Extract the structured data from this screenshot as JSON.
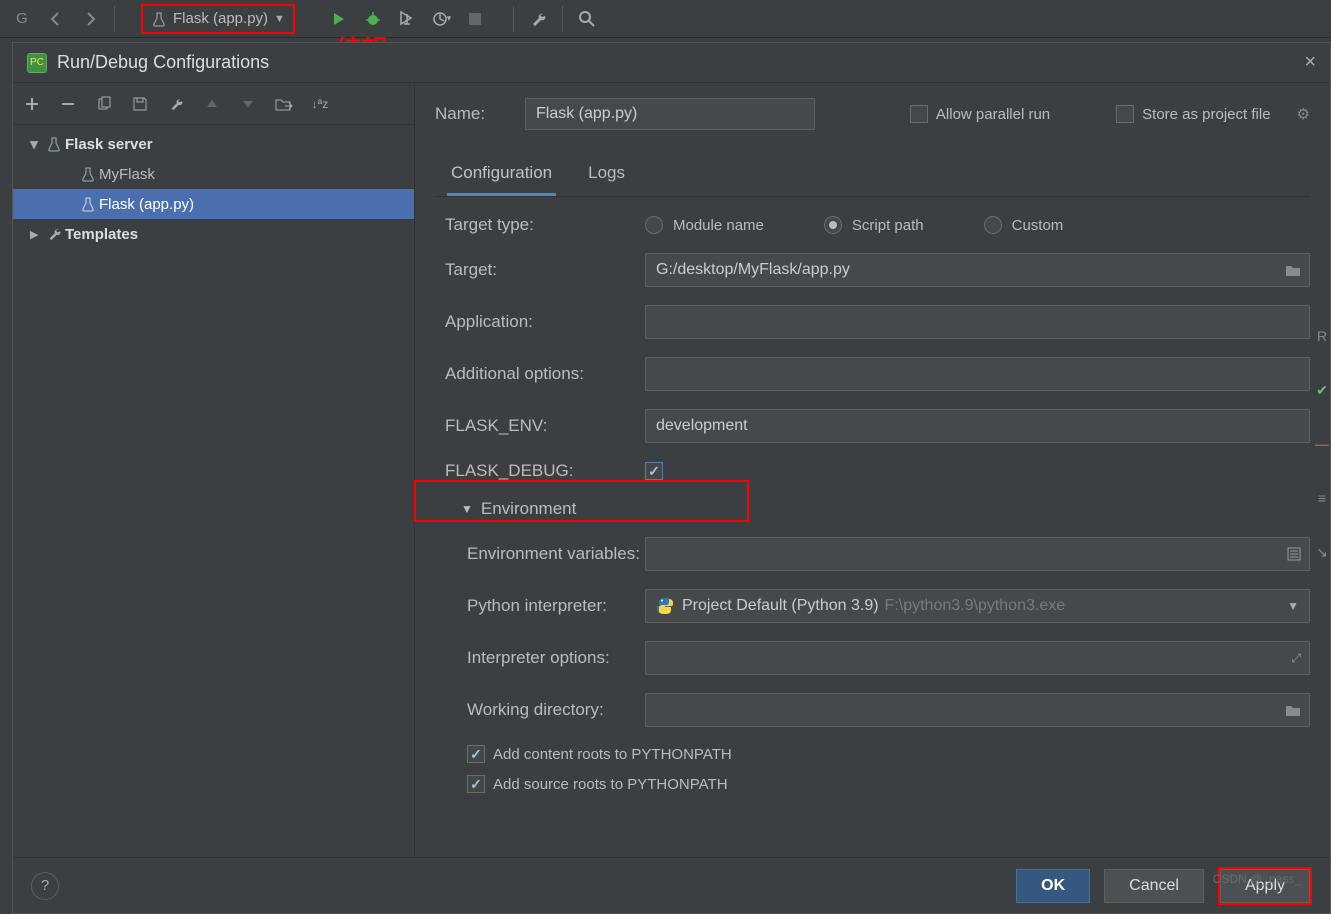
{
  "toolbar": {
    "run_config": "Flask (app.py)"
  },
  "annotation": "编辑",
  "dialog": {
    "title": "Run/Debug Configurations",
    "tree": {
      "root": "Flask server",
      "items": [
        "MyFlask",
        "Flask (app.py)"
      ],
      "templates": "Templates"
    },
    "name_label": "Name:",
    "name_value": "Flask (app.py)",
    "allow_parallel": "Allow parallel run",
    "store_project": "Store as project file",
    "tabs": {
      "config": "Configuration",
      "logs": "Logs"
    },
    "form": {
      "target_type_label": "Target type:",
      "radios": {
        "module": "Module name",
        "script": "Script path",
        "custom": "Custom"
      },
      "target_label": "Target:",
      "target_value": "G:/desktop/MyFlask/app.py",
      "app_label": "Application:",
      "app_value": "",
      "addopt_label": "Additional options:",
      "addopt_value": "",
      "flaskenv_label": "FLASK_ENV:",
      "flaskenv_value": "development",
      "flaskdebug_label": "FLASK_DEBUG:",
      "env_section": "Environment",
      "envvars_label": "Environment variables:",
      "envvars_value": "",
      "interp_label": "Python interpreter:",
      "interp_value": "Project Default (Python 3.9)",
      "interp_path": "F:\\python3.9\\python3.exe",
      "interpopt_label": "Interpreter options:",
      "interpopt_value": "",
      "workdir_label": "Working directory:",
      "workdir_value": "",
      "add_content": "Add content roots to PYTHONPATH",
      "add_source": "Add source roots to PYTHONPATH"
    },
    "buttons": {
      "ok": "OK",
      "cancel": "Cancel",
      "apply": "Apply"
    }
  },
  "watermark": "CSDN @_pass_"
}
